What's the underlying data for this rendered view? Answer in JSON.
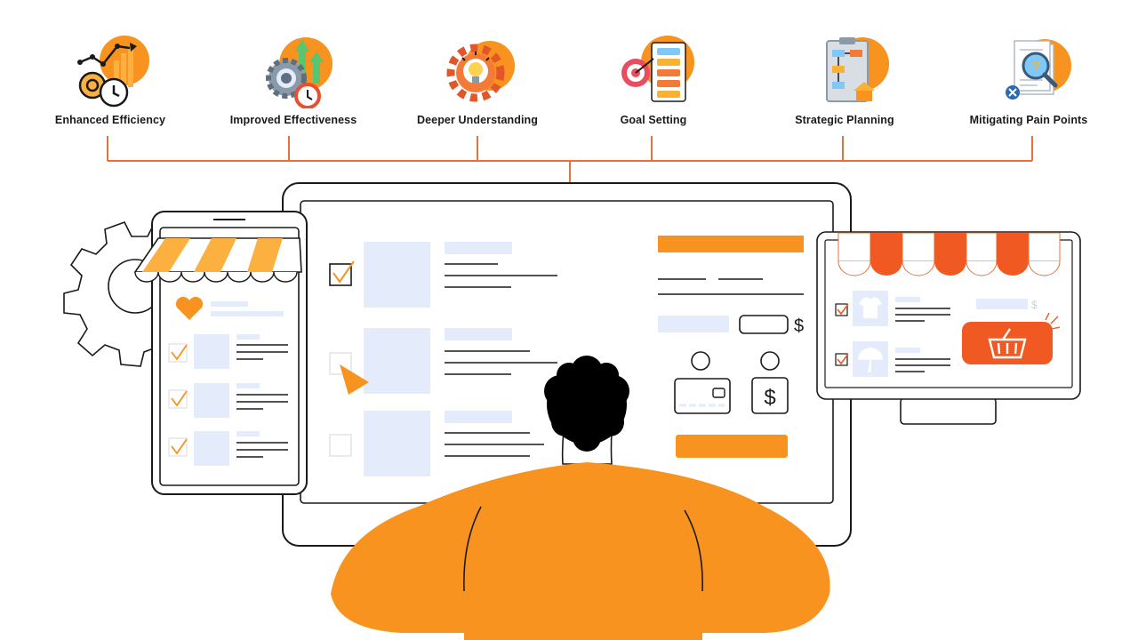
{
  "colors": {
    "accent": "#f7931e",
    "accent_dark": "#f05a22",
    "connector": "#e8703a",
    "placeholder": "#e4ebfb",
    "outline": "#1a1a1a"
  },
  "benefits": [
    {
      "label": "Enhanced Efficiency",
      "icon": "efficiency-chart-icon"
    },
    {
      "label": "Improved Effectiveness",
      "icon": "gear-arrows-icon"
    },
    {
      "label": "Deeper Understanding",
      "icon": "lightbulb-gear-icon"
    },
    {
      "label": "Goal Setting",
      "icon": "target-checklist-icon"
    },
    {
      "label": "Strategic Planning",
      "icon": "flowchart-board-icon"
    },
    {
      "label": "Mitigating Pain Points",
      "icon": "document-magnifier-icon"
    }
  ],
  "checkout": {
    "currency_symbol": "$"
  }
}
